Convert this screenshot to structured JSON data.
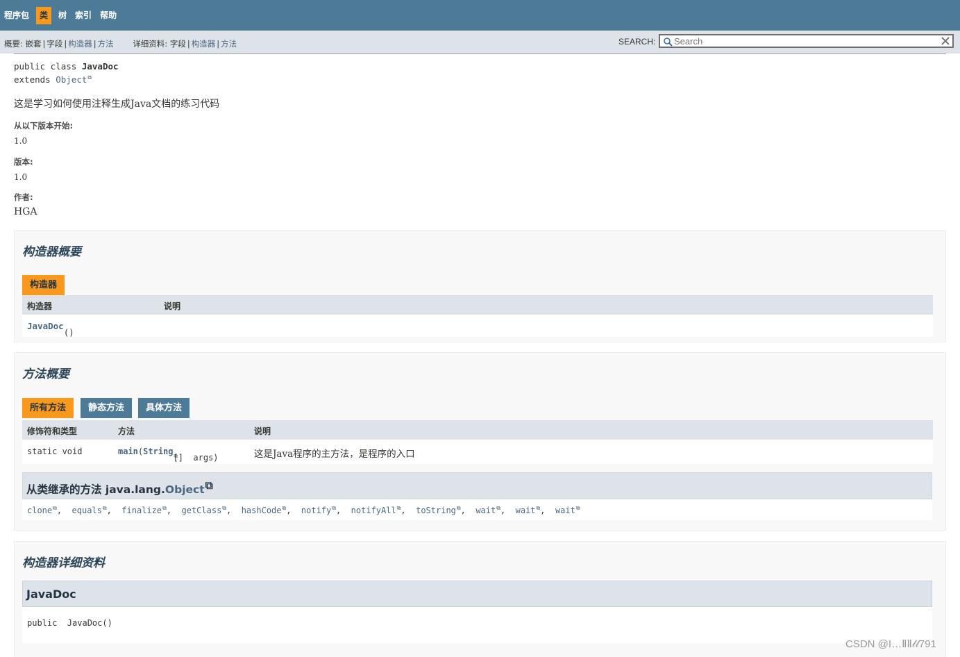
{
  "topnav": {
    "items": [
      {
        "label": "程序包",
        "active": false
      },
      {
        "label": "类",
        "active": true
      },
      {
        "label": "树",
        "active": false
      },
      {
        "label": "索引",
        "active": false
      },
      {
        "label": "帮助",
        "active": false
      }
    ]
  },
  "subnav": {
    "summary_label": "概要:",
    "summary_nested": "嵌套",
    "summary_field": "字段",
    "summary_constructor": "构造器",
    "summary_method": "方法",
    "detail_label": "详细资料:",
    "detail_field": "字段",
    "detail_constructor": "构造器",
    "detail_method": "方法",
    "search_label": "SEARCH:",
    "search_placeholder": "Search"
  },
  "class_header": {
    "sig_public": "public class ",
    "class_name": "JavaDoc",
    "sig_extends": "extends ",
    "super_name": "Object",
    "description": "这是学习如何使用注释生成Java文档的练习代码",
    "since_label": "从以下版本开始:",
    "since_value": "1.0",
    "version_label": "版本:",
    "version_value": "1.0",
    "author_label": "作者:",
    "author_value": "HGA"
  },
  "constructor_summary": {
    "title": "构造器概要",
    "tab": "构造器",
    "col1": "构造器",
    "col2": "说明",
    "row_name": "JavaDoc",
    "row_params": "()"
  },
  "method_summary": {
    "title": "方法概要",
    "tabs": [
      "所有方法",
      "静态方法",
      "具体方法"
    ],
    "col1": "修饰符和类型",
    "col2": "方法",
    "col3": "说明",
    "row_modifier": "static void",
    "row_method": "main",
    "row_param_type": "String",
    "row_param_rest": "[]  args)",
    "row_desc": "这是Java程序的主方法，是程序的入口",
    "inherited_prefix": "从类继承的方法 java.lang.",
    "inherited_class": "Object",
    "inherited_methods": [
      "clone",
      "equals",
      "finalize",
      "getClass",
      "hashCode",
      "notify",
      "notifyAll",
      "toString",
      "wait",
      "wait",
      "wait"
    ]
  },
  "constructor_detail": {
    "title": "构造器详细资料",
    "name": "JavaDoc",
    "signature": "public  JavaDoc()"
  },
  "watermark": "CSDN @I…ⅡⅡ𝓁𝓁791",
  "colors": {
    "nav_bg": "#4d7a97",
    "active_tab": "#f8981d",
    "subnav_bg": "#dee3e9",
    "link": "#4a6782"
  }
}
